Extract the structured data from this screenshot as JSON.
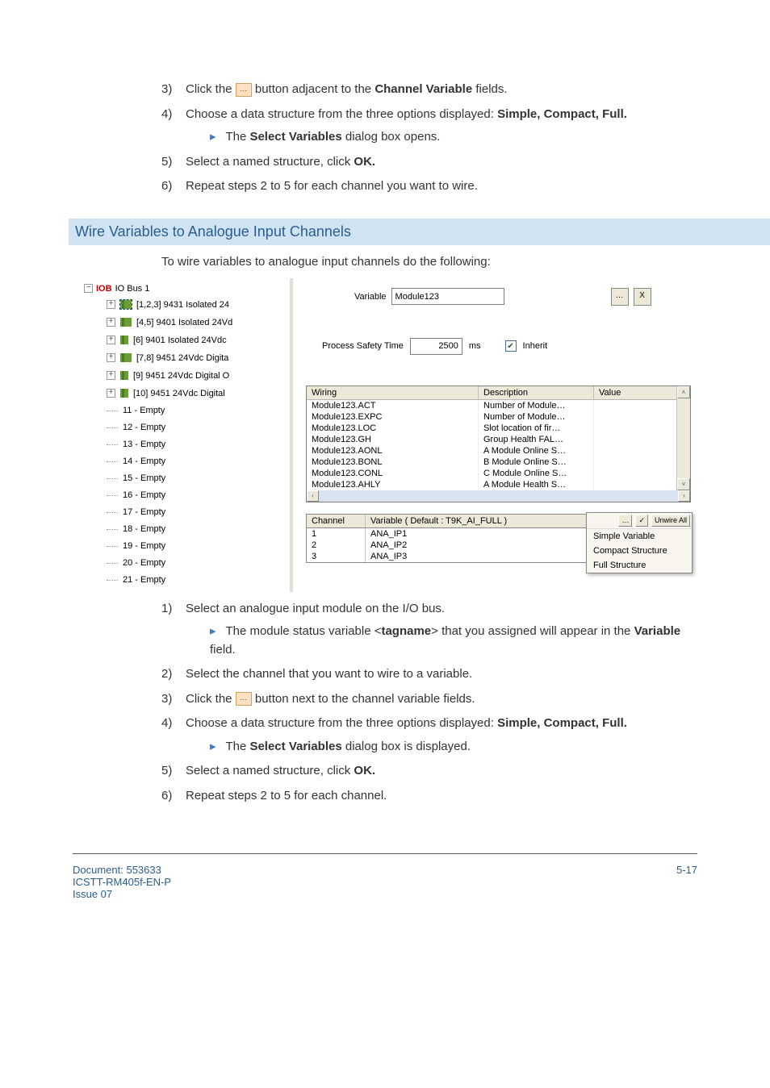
{
  "steps_top": [
    {
      "n": "3)",
      "pre": "Click the ",
      "post": " button adjacent to the ",
      "bold": "Channel Variable",
      "end": " fields."
    },
    {
      "n": "4)",
      "text": "Choose a data structure from the three options displayed: ",
      "bold": "Simple, Compact, Full."
    },
    {
      "n": "5)",
      "text": "Select a named structure, click ",
      "bold": "OK."
    },
    {
      "n": "6)",
      "text": "Repeat steps 2 to 5 for each channel you want to wire."
    }
  ],
  "top_sub": {
    "pre": "The ",
    "bold": "Select Variables",
    "post": " dialog box opens."
  },
  "section_title": "Wire Variables to Analogue Input Channels",
  "section_intro": "To wire variables to analogue input channels do the following:",
  "tree": {
    "root_prefix": "IOB",
    "root_label": "IO Bus 1",
    "modules": [
      {
        "label": "[1,2,3] 9431 Isolated 24",
        "selected": true,
        "multi": true
      },
      {
        "label": "[4,5] 9401 Isolated 24Vd",
        "multi": true
      },
      {
        "label": "[6] 9401 Isolated 24Vdc",
        "multi": false
      },
      {
        "label": "[7,8] 9451 24Vdc Digita",
        "multi": true
      },
      {
        "label": "[9] 9451 24Vdc Digital O",
        "multi": false
      },
      {
        "label": "[10] 9451 24Vdc Digital",
        "multi": false
      }
    ],
    "empties": [
      "11 - Empty",
      "12 - Empty",
      "13 - Empty",
      "14 - Empty",
      "15 - Empty",
      "16 - Empty",
      "17 - Empty",
      "18 - Empty",
      "19 - Empty",
      "20 - Empty",
      "21 - Empty"
    ]
  },
  "form": {
    "variable_label": "Variable",
    "variable_value": "Module123",
    "x": "X",
    "pst_label": "Process Safety Time",
    "pst_value": "2500",
    "pst_unit": "ms",
    "inherit": "Inherit"
  },
  "wiring": {
    "headers": [
      "Wiring",
      "Description",
      "Value"
    ],
    "rows": [
      {
        "w": "Module123.ACT",
        "d": "Number of Module…"
      },
      {
        "w": "Module123.EXPC",
        "d": "Number of Module…"
      },
      {
        "w": "Module123.LOC",
        "d": "Slot location of fir…"
      },
      {
        "w": "Module123.GH",
        "d": "Group Health FAL…"
      },
      {
        "w": "Module123.AONL",
        "d": "A Module Online S…"
      },
      {
        "w": "Module123.BONL",
        "d": "B Module Online S…"
      },
      {
        "w": "Module123.CONL",
        "d": "C Module Online S…"
      },
      {
        "w": "Module123.AHLY",
        "d": "A Module Health S…"
      }
    ]
  },
  "channels": {
    "head_channel": "Channel",
    "head_variable": "Variable ( Default : T9K_AI_FULL )",
    "rows": [
      {
        "c": "1",
        "v": "ANA_IP1"
      },
      {
        "c": "2",
        "v": "ANA_IP2"
      },
      {
        "c": "3",
        "v": "ANA_IP3"
      }
    ]
  },
  "popup": {
    "btn1": "…",
    "btn2": "✓",
    "btn3": "Unwire All",
    "items": [
      "Simple Variable",
      "Compact Structure",
      "Full Structure"
    ]
  },
  "steps_bottom": [
    {
      "n": "1)",
      "text": "Select an analogue input module on the I/O bus."
    },
    {
      "n": "2)",
      "text": "Select the channel that you want to wire to a variable."
    },
    {
      "n": "3)",
      "pre": "Click the ",
      "post": " button next to the channel variable fields."
    },
    {
      "n": "4)",
      "text": "Choose a data structure from the three options displayed: ",
      "bold": "Simple, Compact, Full."
    },
    {
      "n": "5)",
      "text": "Select a named structure, click ",
      "bold": "OK."
    },
    {
      "n": "6)",
      "text": "Repeat steps 2 to 5 for each channel."
    }
  ],
  "sub1": {
    "pre": "The module status variable <",
    "bold": "tagname",
    "mid": "> that you assigned will appear in the ",
    "bold2": "Variable",
    "end": " field."
  },
  "sub2": {
    "pre": "The ",
    "bold": "Select Variables",
    "post": " dialog box is displayed."
  },
  "footer": {
    "doc": "Document: 553633",
    "ref": "ICSTT-RM405f-EN-P",
    "issue": "Issue 07",
    "page": "5-17"
  }
}
